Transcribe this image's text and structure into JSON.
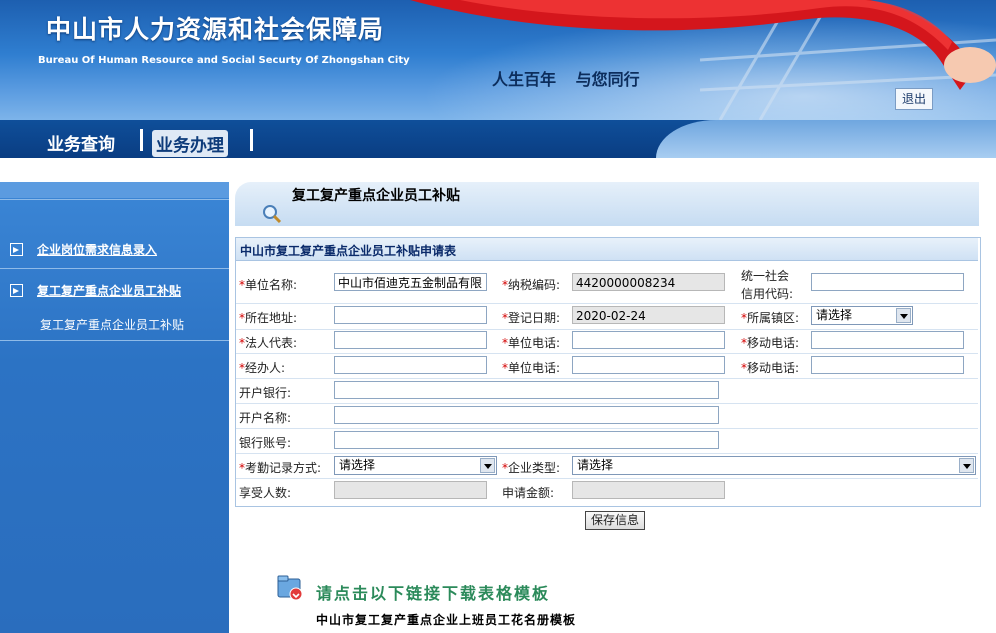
{
  "header": {
    "title_cn": "中山市人力资源和社会保障局",
    "title_en": "Bureau Of Human Resource and Social Securty Of Zhongshan City",
    "slogan": "人生百年 与您同行",
    "logout_label": "退出"
  },
  "nav": {
    "items": [
      {
        "label": "业务查询"
      },
      {
        "label": "业务办理"
      }
    ]
  },
  "sidebar": {
    "items": [
      {
        "label": "企业岗位需求信息录入"
      },
      {
        "label": "复工复产重点企业员工补贴"
      }
    ],
    "sub_item": "复工复产重点企业员工补贴"
  },
  "page": {
    "title": "复工复产重点企业员工补贴",
    "form_title": "中山市复工复产重点企业员工补贴申请表"
  },
  "form": {
    "star": "*",
    "company_name": {
      "label": "单位名称:",
      "value": "中山市佰迪克五金制品有限"
    },
    "tax_no": {
      "label": "纳税编码:",
      "value": "4420000008234"
    },
    "credit_code": {
      "label1": "统一社会",
      "label2": "信用代码:",
      "value": ""
    },
    "address": {
      "label": "所在地址:",
      "value": ""
    },
    "reg_date": {
      "label": "登记日期:",
      "value": "2020-02-24"
    },
    "district": {
      "label": "所属镇区:",
      "value": "请选择"
    },
    "legal_rep": {
      "label": "法人代表:",
      "value": ""
    },
    "unit_phone1": {
      "label": "单位电话:",
      "value": ""
    },
    "mobile1": {
      "label": "移动电话:",
      "value": ""
    },
    "handler": {
      "label": "经办人:",
      "value": ""
    },
    "unit_phone2": {
      "label": "单位电话:",
      "value": ""
    },
    "mobile2": {
      "label": "移动电话:",
      "value": ""
    },
    "bank": {
      "label": "开户银行:",
      "value": ""
    },
    "account_name": {
      "label": "开户名称:",
      "value": ""
    },
    "account_no": {
      "label": "银行账号:",
      "value": ""
    },
    "attendance": {
      "label": "考勤记录方式:",
      "value": "请选择"
    },
    "company_type": {
      "label": "企业类型:",
      "value": "请选择"
    },
    "beneficiaries": {
      "label": "享受人数:",
      "value": ""
    },
    "amount": {
      "label": "申请金额:",
      "value": ""
    },
    "save_label": "保存信息"
  },
  "download": {
    "title": "请点击以下链接下载表格模板",
    "link": "中山市复工复产重点企业上班员工花名册模板"
  }
}
